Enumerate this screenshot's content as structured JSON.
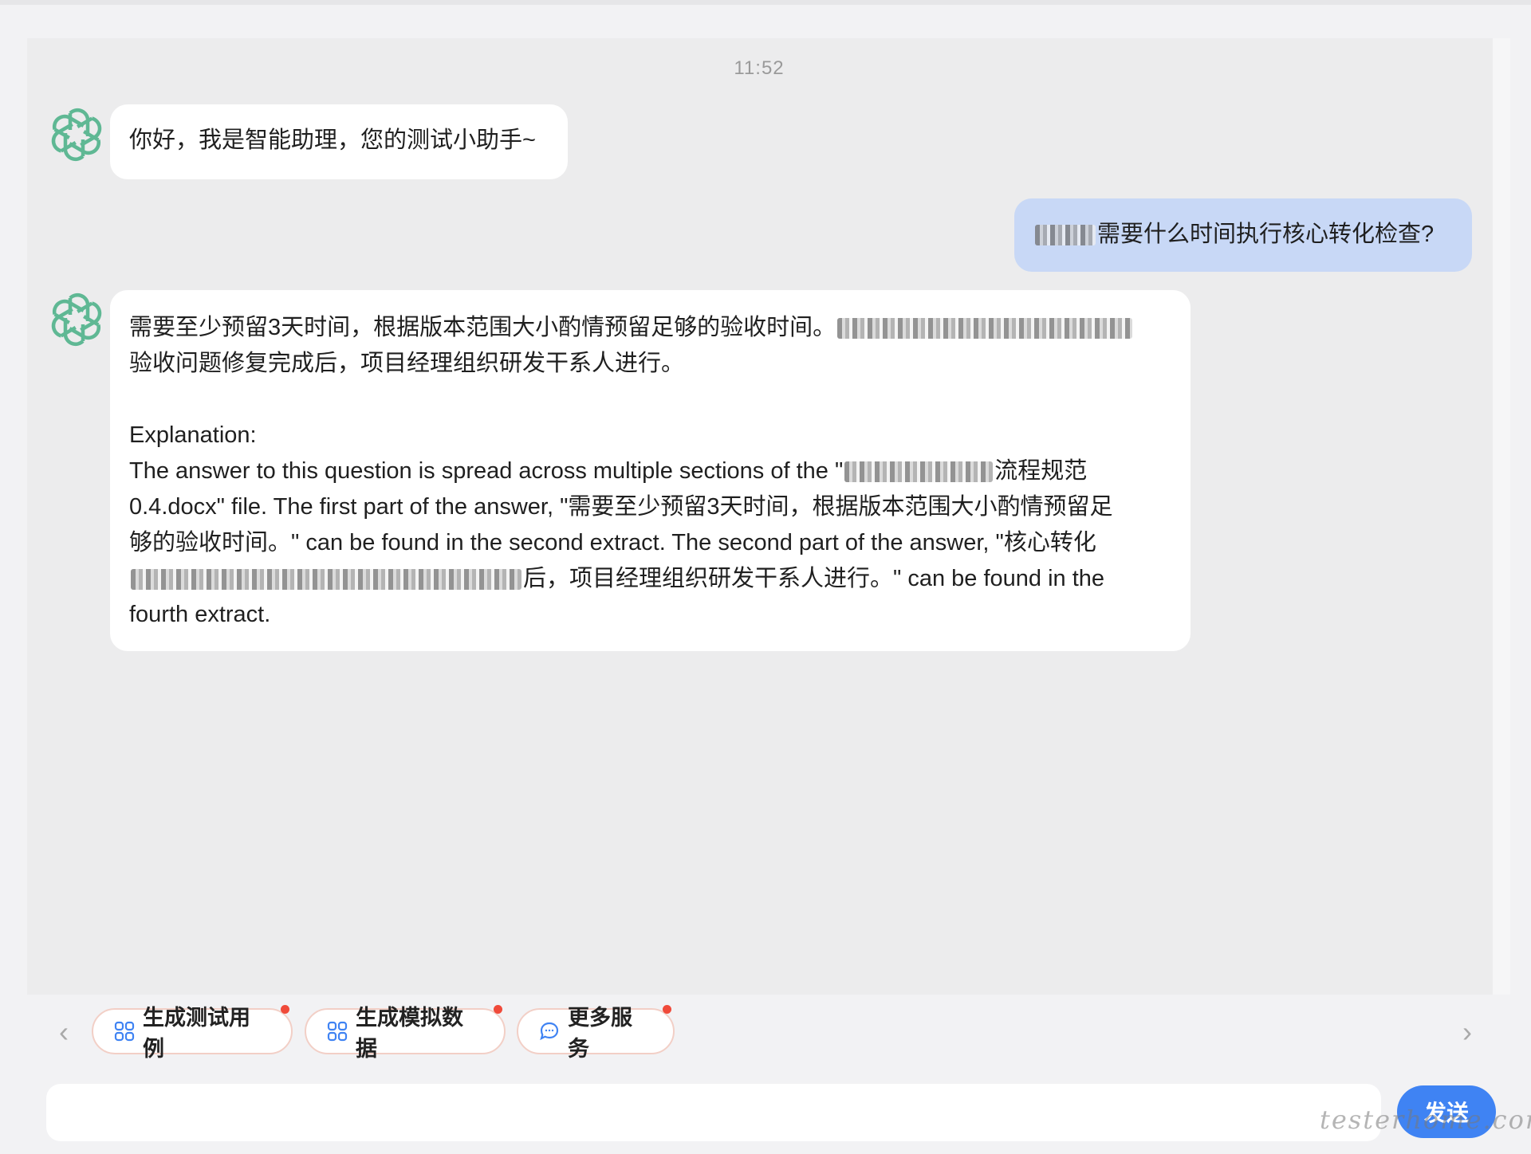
{
  "chat": {
    "timestamp": "11:52",
    "greeting": "你好，我是智能助理，您的测试小助手~",
    "user_question": {
      "visible_text": "需要什么时间执行核心转化检查?"
    },
    "answer": {
      "line1_text": "需要至少预留3天时间，根据版本范围大小酌情预留足够的验收时间。",
      "line2_text": "验收问题修复完成后，项目经理组织研发干系人进行。",
      "explanation_label": "Explanation:",
      "explanation_line1": "The answer to this question is spread across multiple sections of the \"",
      "explanation_line1_tail": "流程规范",
      "explanation_line2": "0.4.docx\" file. The first part of the answer, \"需要至少预留3天时间，根据版本范围大小酌情预留足",
      "explanation_line3": "够的验收时间。\" can be found in the second extract. The second part of the answer, \"核心转化",
      "explanation_line4_tail": "后，项目经理组织研发干系人进行。\" can be found in the",
      "explanation_line5": "fourth extract."
    }
  },
  "suggestions": [
    {
      "label": "生成测试用例",
      "icon": "grid-icon"
    },
    {
      "label": "生成模拟数据",
      "icon": "grid-icon"
    },
    {
      "label": "更多服务",
      "icon": "chat-bubble-icon"
    }
  ],
  "navigation": {
    "left_arrow": "‹",
    "right_arrow": "›"
  },
  "composer": {
    "placeholder": "",
    "send_label": "发送"
  },
  "watermark": "testerhome.com",
  "colors": {
    "accent": "#3f83f3",
    "user_bubble": "#c8d8f6",
    "avatar_green": "#5fb894",
    "notification_dot": "#f04a3a"
  }
}
